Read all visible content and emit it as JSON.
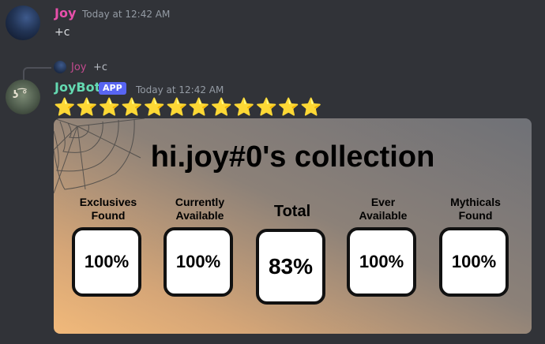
{
  "message1": {
    "username": "Joy",
    "timestamp": "Today at 12:42 AM",
    "content": "+c"
  },
  "message2": {
    "reply_to": {
      "username": "Joy",
      "content": "+c"
    },
    "username": "JoyBot",
    "badge": "APP",
    "timestamp": "Today at 12:42 AM",
    "stars": "⭐⭐⭐⭐⭐⭐⭐⭐⭐⭐⭐⭐",
    "avatar_text": "ʖ ͡°"
  },
  "card": {
    "title": "hi.joy#0's collection",
    "stats": [
      {
        "label_line1": "Exclusives",
        "label_line2": "Found",
        "value": "100%"
      },
      {
        "label_line1": "Currently",
        "label_line2": "Available",
        "value": "100%"
      },
      {
        "label_line1": "Total",
        "label_line2": "",
        "value": "83%"
      },
      {
        "label_line1": "Ever",
        "label_line2": "Available",
        "value": "100%"
      },
      {
        "label_line1": "Mythicals",
        "label_line2": "Found",
        "value": "100%"
      }
    ]
  },
  "colors": {
    "background": "#313338",
    "joy_name": "#e74faa",
    "bot_name": "#64d9b1",
    "app_badge": "#5865f2",
    "star": "#ffac33"
  },
  "icons": {
    "avatar_joy": "avatar",
    "avatar_bot": "avatar",
    "reply": "reply-connector-icon",
    "web": "spider-web-icon"
  }
}
